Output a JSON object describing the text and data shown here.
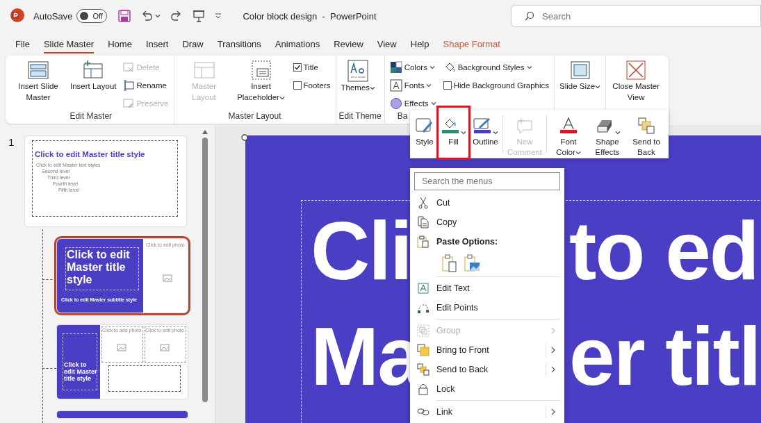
{
  "title_bar": {
    "autosave": {
      "label": "AutoSave",
      "on": false,
      "state_text": "Off"
    },
    "title": "Color block design  -  PowerPoint",
    "search": {
      "placeholder": "Search"
    }
  },
  "tabs": [
    {
      "label": "File",
      "selected": false,
      "kind": "normal"
    },
    {
      "label": "Slide Master",
      "selected": true,
      "kind": "normal"
    },
    {
      "label": "Home",
      "selected": false,
      "kind": "normal"
    },
    {
      "label": "Insert",
      "selected": false,
      "kind": "normal"
    },
    {
      "label": "Draw",
      "selected": false,
      "kind": "normal"
    },
    {
      "label": "Transitions",
      "selected": false,
      "kind": "normal"
    },
    {
      "label": "Animations",
      "selected": false,
      "kind": "normal"
    },
    {
      "label": "Review",
      "selected": false,
      "kind": "normal"
    },
    {
      "label": "View",
      "selected": false,
      "kind": "normal"
    },
    {
      "label": "Help",
      "selected": false,
      "kind": "normal"
    },
    {
      "label": "Shape Format",
      "selected": false,
      "kind": "contextual"
    }
  ],
  "ribbon": {
    "groups": [
      {
        "label": "Edit Master",
        "items": [
          {
            "kind": "large",
            "label": "Insert Slide Master",
            "disabled": false,
            "dropdown": false
          },
          {
            "kind": "large",
            "label": "Insert Layout",
            "disabled": false,
            "dropdown": false
          },
          {
            "kind": "small",
            "label": "Delete",
            "disabled": true,
            "dropdown": false
          },
          {
            "kind": "small",
            "label": "Rename",
            "disabled": false,
            "dropdown": false
          },
          {
            "kind": "small",
            "label": "Preserve",
            "disabled": true,
            "dropdown": false
          }
        ]
      },
      {
        "label": "Master Layout",
        "items": [
          {
            "kind": "large",
            "label": "Master Layout",
            "disabled": true,
            "dropdown": false
          },
          {
            "kind": "large",
            "label": "Insert Placeholder",
            "disabled": false,
            "dropdown": true
          },
          {
            "kind": "check",
            "label": "Title",
            "checked": true
          },
          {
            "kind": "check",
            "label": "Footers",
            "checked": false
          }
        ]
      },
      {
        "label": "Edit Theme",
        "items": [
          {
            "kind": "large",
            "label": "Themes",
            "disabled": false,
            "dropdown": true
          }
        ]
      },
      {
        "label": "Ba",
        "items": [
          {
            "kind": "small",
            "label": "Colors",
            "disabled": false,
            "dropdown": true
          },
          {
            "kind": "small",
            "label": "Fonts",
            "disabled": false,
            "dropdown": true
          },
          {
            "kind": "small",
            "label": "Effects",
            "disabled": false,
            "dropdown": true
          },
          {
            "kind": "small",
            "label": "Background Styles",
            "disabled": false,
            "dropdown": true
          },
          {
            "kind": "check",
            "label": "Hide Background Graphics",
            "checked": false
          }
        ]
      },
      {
        "items": [
          {
            "kind": "large",
            "label": "Slide Size",
            "disabled": false,
            "dropdown": true
          }
        ]
      },
      {
        "items": [
          {
            "kind": "large",
            "label": "Close Master View",
            "disabled": false,
            "dropdown": false
          }
        ]
      }
    ]
  },
  "thumbnails": [
    {
      "number": "1",
      "kind": "title-content",
      "selected": false,
      "title": "Click to edit Master title style",
      "body_levels": [
        "Click to edit Master text styles",
        "Second level",
        "Third level",
        "Fourth level",
        "Fifth level"
      ]
    },
    {
      "kind": "title-photo",
      "selected": true,
      "title": "Click to edit Master title style",
      "subtitle": "Click to edit Master subtitle style",
      "photo_labels": [
        "Click to edit photo"
      ]
    },
    {
      "kind": "two-photo",
      "selected": false,
      "title": "Click to edit Master title style",
      "photo_labels": [
        "Click to add photo",
        "Click to edit photo"
      ]
    },
    {
      "kind": "blank",
      "selected": false
    }
  ],
  "slide": {
    "title_lines": [
      [
        "Cli",
        "to ed"
      ],
      [
        "Ma",
        "er titl"
      ]
    ]
  },
  "mini_toolbar": [
    {
      "label": "Style",
      "dropdown": false,
      "disabled": false,
      "selected": false
    },
    {
      "label": "Fill",
      "dropdown": true,
      "disabled": false,
      "selected": true
    },
    {
      "label": "Outline",
      "dropdown": true,
      "disabled": false,
      "selected": false
    },
    {
      "label": "New Comment",
      "dropdown": false,
      "disabled": true,
      "selected": false
    },
    {
      "label": "Font Color",
      "dropdown": true,
      "disabled": false,
      "selected": false
    },
    {
      "label": "Shape Effects",
      "dropdown": true,
      "disabled": false,
      "selected": false
    },
    {
      "label": "Send to Back",
      "dropdown": false,
      "disabled": false,
      "selected": false
    }
  ],
  "context_menu": {
    "search": {
      "placeholder": "Search the menus"
    },
    "items": [
      {
        "kind": "item",
        "label": "Cut",
        "disabled": false,
        "submenu": false
      },
      {
        "kind": "item",
        "label": "Copy",
        "disabled": false,
        "submenu": false
      },
      {
        "kind": "header",
        "label": "Paste Options:"
      },
      {
        "kind": "paste"
      },
      {
        "kind": "separator"
      },
      {
        "kind": "item",
        "label": "Edit Text",
        "disabled": false,
        "submenu": false
      },
      {
        "kind": "item",
        "label": "Edit Points",
        "disabled": false,
        "submenu": false
      },
      {
        "kind": "separator"
      },
      {
        "kind": "item",
        "label": "Group",
        "disabled": true,
        "submenu": true,
        "split": false
      },
      {
        "kind": "item",
        "label": "Bring to Front",
        "disabled": false,
        "submenu": true,
        "split": true
      },
      {
        "kind": "item",
        "label": "Send to Back",
        "disabled": false,
        "submenu": true,
        "split": true
      },
      {
        "kind": "item",
        "label": "Lock",
        "disabled": false,
        "submenu": false
      },
      {
        "kind": "separator"
      },
      {
        "kind": "item",
        "label": "Link",
        "disabled": false,
        "submenu": true,
        "split": true
      }
    ]
  }
}
